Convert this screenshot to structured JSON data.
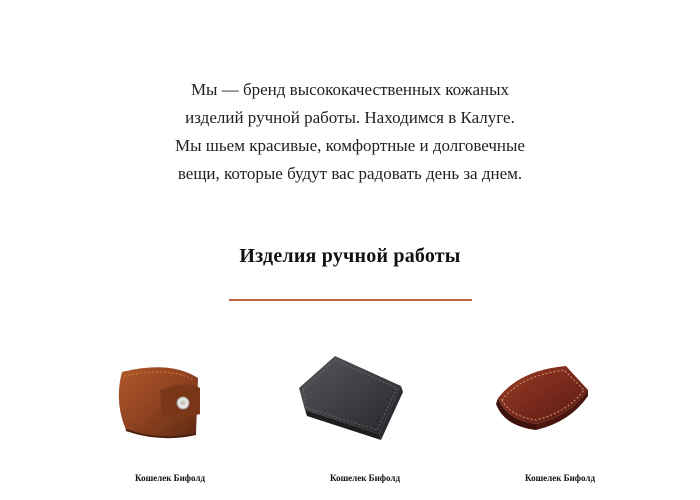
{
  "intro": {
    "lines": [
      "Мы — бренд высококачественных кожаных",
      "изделий ручной работы. Находимся в Калуге.",
      "Мы шьем красивые, комфортные и долговечные",
      "вещи, которые будут вас радовать день за днем."
    ]
  },
  "section": {
    "title": "Изделия ручной работы",
    "accent_color": "#c2623b"
  },
  "products": [
    {
      "name": "Кошелек Бифолд",
      "image": "brown-wallet-icon",
      "color": "#8a3f1c"
    },
    {
      "name": "Кошелек Бифолд",
      "image": "black-wallet-icon",
      "color": "#3a3b3e"
    },
    {
      "name": "Кошелек Бифолд",
      "image": "burgundy-wallet-icon",
      "color": "#7a2a1d"
    }
  ]
}
